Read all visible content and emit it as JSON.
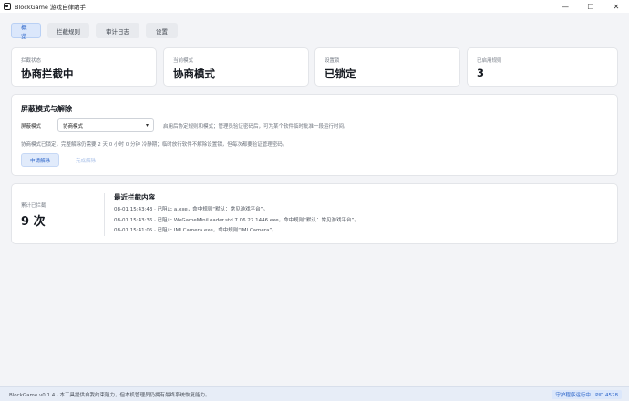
{
  "window": {
    "title": "BlockGame 游戏自律助手",
    "minimize": "—",
    "maximize": "☐",
    "close": "✕"
  },
  "tabs": [
    {
      "label": "概览",
      "active": true
    },
    {
      "label": "拦截规则",
      "active": false
    },
    {
      "label": "审计日志",
      "active": false
    },
    {
      "label": "设置",
      "active": false
    }
  ],
  "stats": [
    {
      "label": "拦截状态",
      "value": "协商拦截中"
    },
    {
      "label": "当前模式",
      "value": "协商模式"
    },
    {
      "label": "设置锁",
      "value": "已锁定"
    },
    {
      "label": "已启用规则",
      "value": "3"
    }
  ],
  "mode_card": {
    "title": "屏蔽模式与解除",
    "select_label": "屏蔽模式",
    "select_value": "协商模式",
    "hint": "启用后协定规则和模式；管理员验证密码后，可为某个软件临时批准一段运行时间。",
    "notice": "协商模式已锁定，完整解除仍需要 2 天 0 小时 0 分钟 冷静期；临时放行软件不解除设置锁，但每次都要验证管理密码。",
    "request_button": "申请解除",
    "finish_button": "完成解除"
  },
  "stats_card": {
    "total_label": "累计已拦截",
    "total_value": "9 次",
    "recent_title": "最近拦截内容",
    "recent_items": [
      "08-01 15:43:43 · 已阻止 a.exe，命中规则“默认：常见游戏平台”。",
      "08-01 15:43:36 · 已阻止 WeGameMiniLoader.std.7.06.27.1446.exe，命中规则“默认：常见游戏平台”。",
      "08-01 15:41:05 · 已阻止 IMI Camera.exe，命中规则“IMI Camera”。"
    ]
  },
  "statusbar": {
    "text": "BlockGame v0.1.4 · 本工具提供自我约束阻力，但本机管理员仍拥有最终系统恢复能力。",
    "badge": "守护程序运行中 · PID 4528"
  }
}
